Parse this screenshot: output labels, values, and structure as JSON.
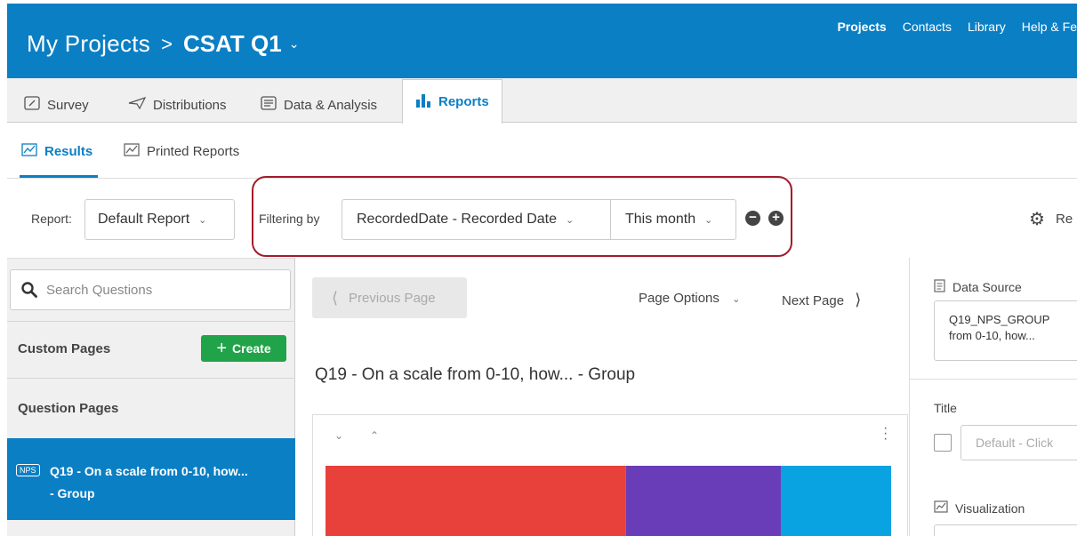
{
  "header": {
    "home": "My Projects",
    "separator": ">",
    "project": "CSAT Q1",
    "nav": {
      "projects": "Projects",
      "contacts": "Contacts",
      "library": "Library",
      "help": "Help & Fe"
    }
  },
  "tabs": {
    "survey": "Survey",
    "distributions": "Distributions",
    "data_analysis": "Data & Analysis",
    "reports": "Reports"
  },
  "subtabs": {
    "results": "Results",
    "printed_reports": "Printed Reports"
  },
  "toolbar": {
    "report_label": "Report:",
    "report_value": "Default Report",
    "filtering_label": "Filtering by",
    "filter_field": "RecordedDate - Recorded Date",
    "filter_range": "This month",
    "settings_label": "Re"
  },
  "sidebar": {
    "search_placeholder": "Search Questions",
    "custom_pages": "Custom Pages",
    "create_label": "Create",
    "question_pages": "Question Pages",
    "question_item": {
      "badge": "NPS",
      "line1": "Q19 - On a scale from 0-10, how...",
      "line2": "- Group"
    }
  },
  "main": {
    "prev_page": "Previous Page",
    "page_options": "Page Options",
    "next_page": "Next Page",
    "title": "Q19 - On a scale from 0-10, how... - Group"
  },
  "chart": {
    "segments": [
      {
        "color": "#e8403a",
        "share": 0.531
      },
      {
        "color": "#6a3db8",
        "share": 0.274
      },
      {
        "color": "#0aa3e2",
        "share": 0.195
      }
    ]
  },
  "right_panel": {
    "data_source_label": "Data Source",
    "data_source_line1": "Q19_NPS_GROUP",
    "data_source_line2": "from 0-10, how...",
    "title_label": "Title",
    "title_placeholder": "Default - Click",
    "visualization_label": "Visualization"
  },
  "colors": {
    "brand_blue": "#0b7fc4",
    "create_green": "#21a349",
    "highlight_red": "#a31c2b"
  }
}
